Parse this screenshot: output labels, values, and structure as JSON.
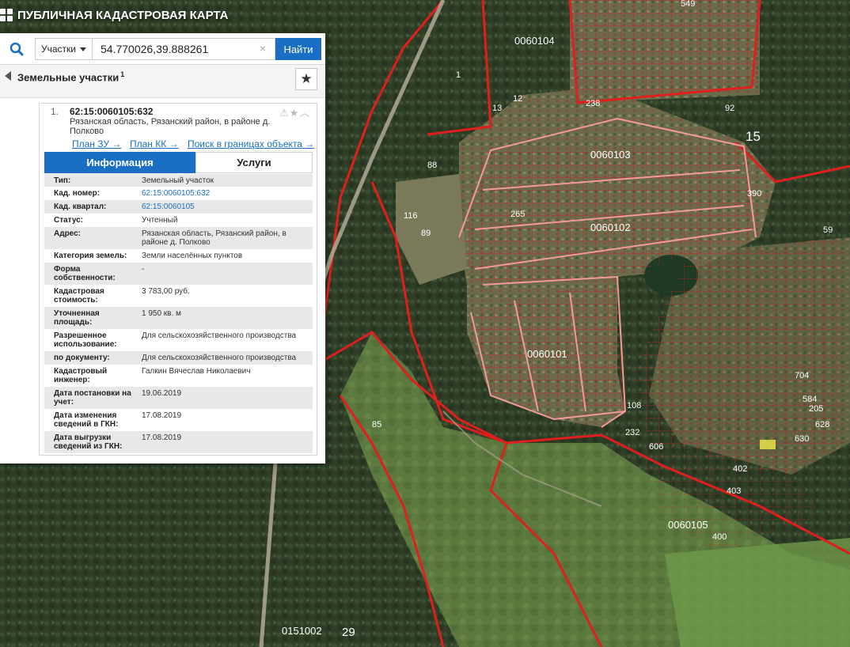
{
  "app": {
    "title": "ПУБЛИЧНАЯ КАДАСТРОВАЯ КАРТА"
  },
  "search": {
    "type_label": "Участки",
    "query": "54.770026,39.888261",
    "clear": "×",
    "find_label": "Найти"
  },
  "section": {
    "title": "Земельные участки",
    "count": "1"
  },
  "card": {
    "index": "1.",
    "cadnum": "62:15:0060105:632",
    "address": "Рязанская область, Рязанский район, в районе д. Полково",
    "links": [
      "План ЗУ →",
      "План КК →",
      "Поиск в границах объекта →"
    ]
  },
  "tabs": {
    "info": "Информация",
    "services": "Услуги"
  },
  "info_rows": [
    {
      "k": "Тип:",
      "v": "Земельный участок"
    },
    {
      "k": "Кад. номер:",
      "v": "62:15:0060105:632"
    },
    {
      "k": "Кад. квартал:",
      "v": "62:15:0060105"
    },
    {
      "k": "Статус:",
      "v": "Учтенный"
    },
    {
      "k": "Адрес:",
      "v": "Рязанская область, Рязанский район, в районе д. Полково"
    },
    {
      "k": "Категория земель:",
      "v": "Земли населённых пунктов"
    },
    {
      "k": "Форма собственности:",
      "v": "-"
    },
    {
      "k": "Кадастровая стоимость:",
      "v": "3 783,00 руб."
    },
    {
      "k": "Уточненная площадь:",
      "v": "1 950 кв. м"
    },
    {
      "k": "Разрешенное использование:",
      "v": "Для сельскохозяйственного производства"
    },
    {
      "k": "по документу:",
      "v": "Для сельскохозяйственного производства"
    },
    {
      "k": "Кадастровый инженер:",
      "v": "Галкин Вячеслав Николаевич"
    },
    {
      "k": "Дата постановки на учет:",
      "v": "19.06.2019"
    },
    {
      "k": "Дата изменения сведений в ГКН:",
      "v": "17.08.2019"
    },
    {
      "k": "Дата выгрузки сведений из ГКН:",
      "v": "17.08.2019"
    }
  ],
  "map": {
    "quarters": [
      "0060104",
      "0060103",
      "0060102",
      "0060101",
      "0060105",
      "0151002"
    ],
    "parcels": [
      "549",
      "1",
      "13",
      "12",
      "238",
      "92",
      "15",
      "88",
      "116",
      "89",
      "265",
      "390",
      "59",
      "85",
      "704",
      "584",
      "205",
      "628",
      "630",
      "108",
      "232",
      "606",
      "402",
      "403",
      "400",
      "29"
    ]
  },
  "colors": {
    "accent": "#1a6fc4",
    "boundary": "#e01e1e"
  }
}
